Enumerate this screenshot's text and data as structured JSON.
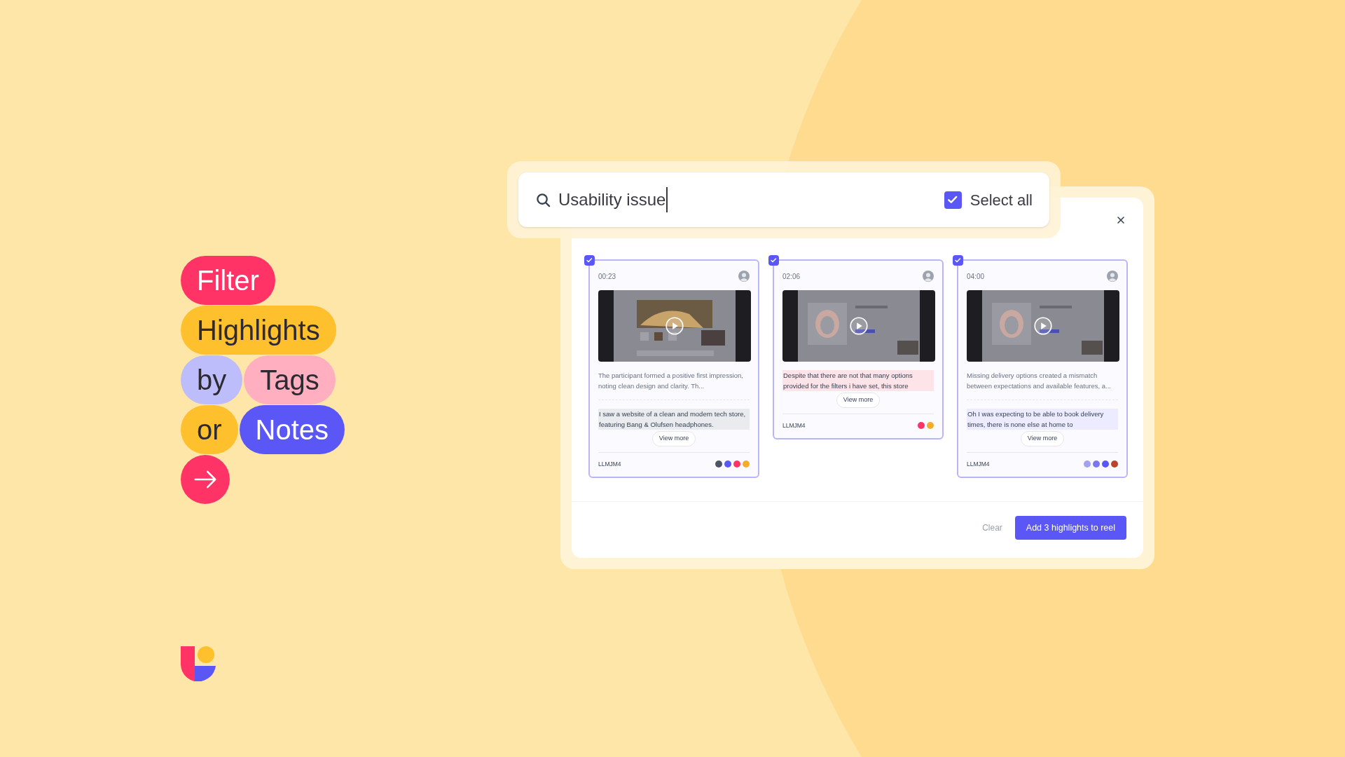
{
  "headline": {
    "rows": [
      [
        {
          "text": "Filter",
          "color": "#ff3366",
          "dark_text": false
        }
      ],
      [
        {
          "text": "Highlights",
          "color": "#ffc02e",
          "dark_text": true
        }
      ],
      [
        {
          "text": "by",
          "color": "#bdbdfb",
          "dark_text": true
        },
        {
          "text": "Tags",
          "color": "#ffafc0",
          "dark_text": true
        }
      ],
      [
        {
          "text": "or",
          "color": "#ffc02e",
          "dark_text": true
        },
        {
          "text": "Notes",
          "color": "#5b57f6",
          "dark_text": false
        }
      ]
    ]
  },
  "search": {
    "value": "Usability issue",
    "select_all": {
      "label": "Select all",
      "checked": true
    }
  },
  "cards": [
    {
      "selected": true,
      "time": "00:23",
      "note": "The participant formed a positive first impression, noting clean design and clarity. Th...",
      "quote": {
        "text": "I saw a website of a clean and modern tech store, featuring Bang & Olufsen headphones.",
        "color": "#e9ebee"
      },
      "view_more": "View more",
      "participant": "LLMJM4",
      "tags": [
        {
          "color": "#4b5563"
        },
        {
          "color": "#5b57f6"
        },
        {
          "color": "#ff3366"
        },
        {
          "color": "#f4ad2a"
        }
      ]
    },
    {
      "selected": true,
      "time": "02:06",
      "quote": {
        "text": "Despite that there are not that many options provided for the filters i have set, this store",
        "color": "#fde4e8"
      },
      "view_more": "View more",
      "participant": "LLMJM4",
      "tags": [
        {
          "color": "#ff3366"
        },
        {
          "color": "#f4ad2a"
        }
      ]
    },
    {
      "selected": true,
      "time": "04:00",
      "note": "Missing delivery options created a mismatch between expectations and available features, a...",
      "quote": {
        "text": "Oh I was expecting to be able to book delivery times, there is none else at home to",
        "color": "#ecebff"
      },
      "view_more": "View more",
      "participant": "LLMJM4",
      "tags": [
        {
          "color": "#a3a1f0"
        },
        {
          "color": "#7b78ef"
        },
        {
          "color": "#5b57f6"
        },
        {
          "color": "#b8442e"
        }
      ]
    }
  ],
  "footer": {
    "clear": "Clear",
    "add": "Add 3 highlights to reel"
  }
}
